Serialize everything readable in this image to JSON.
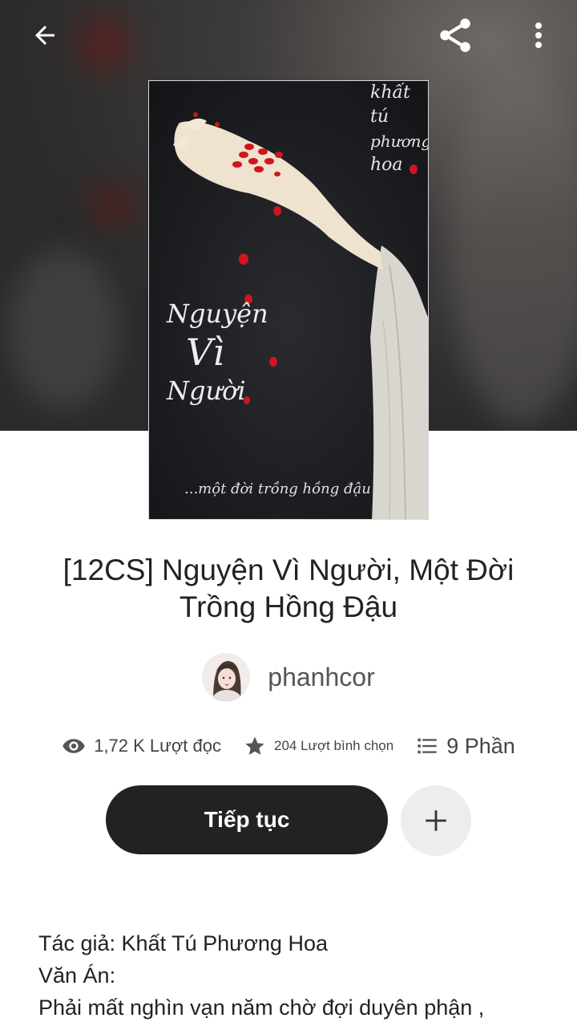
{
  "header": {
    "back_icon": "arrow-left-icon",
    "share_icon": "share-icon",
    "more_icon": "more-vertical-icon"
  },
  "cover": {
    "author_lines": [
      "khất",
      "tú",
      "phương",
      "hoa"
    ],
    "title_lines": [
      "Nguyện",
      "Vì",
      "Người"
    ],
    "subtitle": "...một đời trồng hồng đậu"
  },
  "story": {
    "title": "[12CS] Nguyện Vì Người, Một Đời Trồng Hồng Đậu",
    "author": "phanhcor"
  },
  "stats": {
    "reads": "1,72 K Lượt đọc",
    "votes": "204 Lượt bình chọn",
    "parts": "9 Phần"
  },
  "actions": {
    "continue_label": "Tiếp tục",
    "add_icon": "plus-icon"
  },
  "description": {
    "line1": "Tác giả: Khất Tú Phương Hoa",
    "line2": "Văn Án:",
    "line3": "Phải mất nghìn vạn năm chờ đợi duyên phận ,"
  },
  "colors": {
    "button_dark": "#222222",
    "add_button_bg": "#ededed",
    "bean_red": "#d0151f"
  }
}
